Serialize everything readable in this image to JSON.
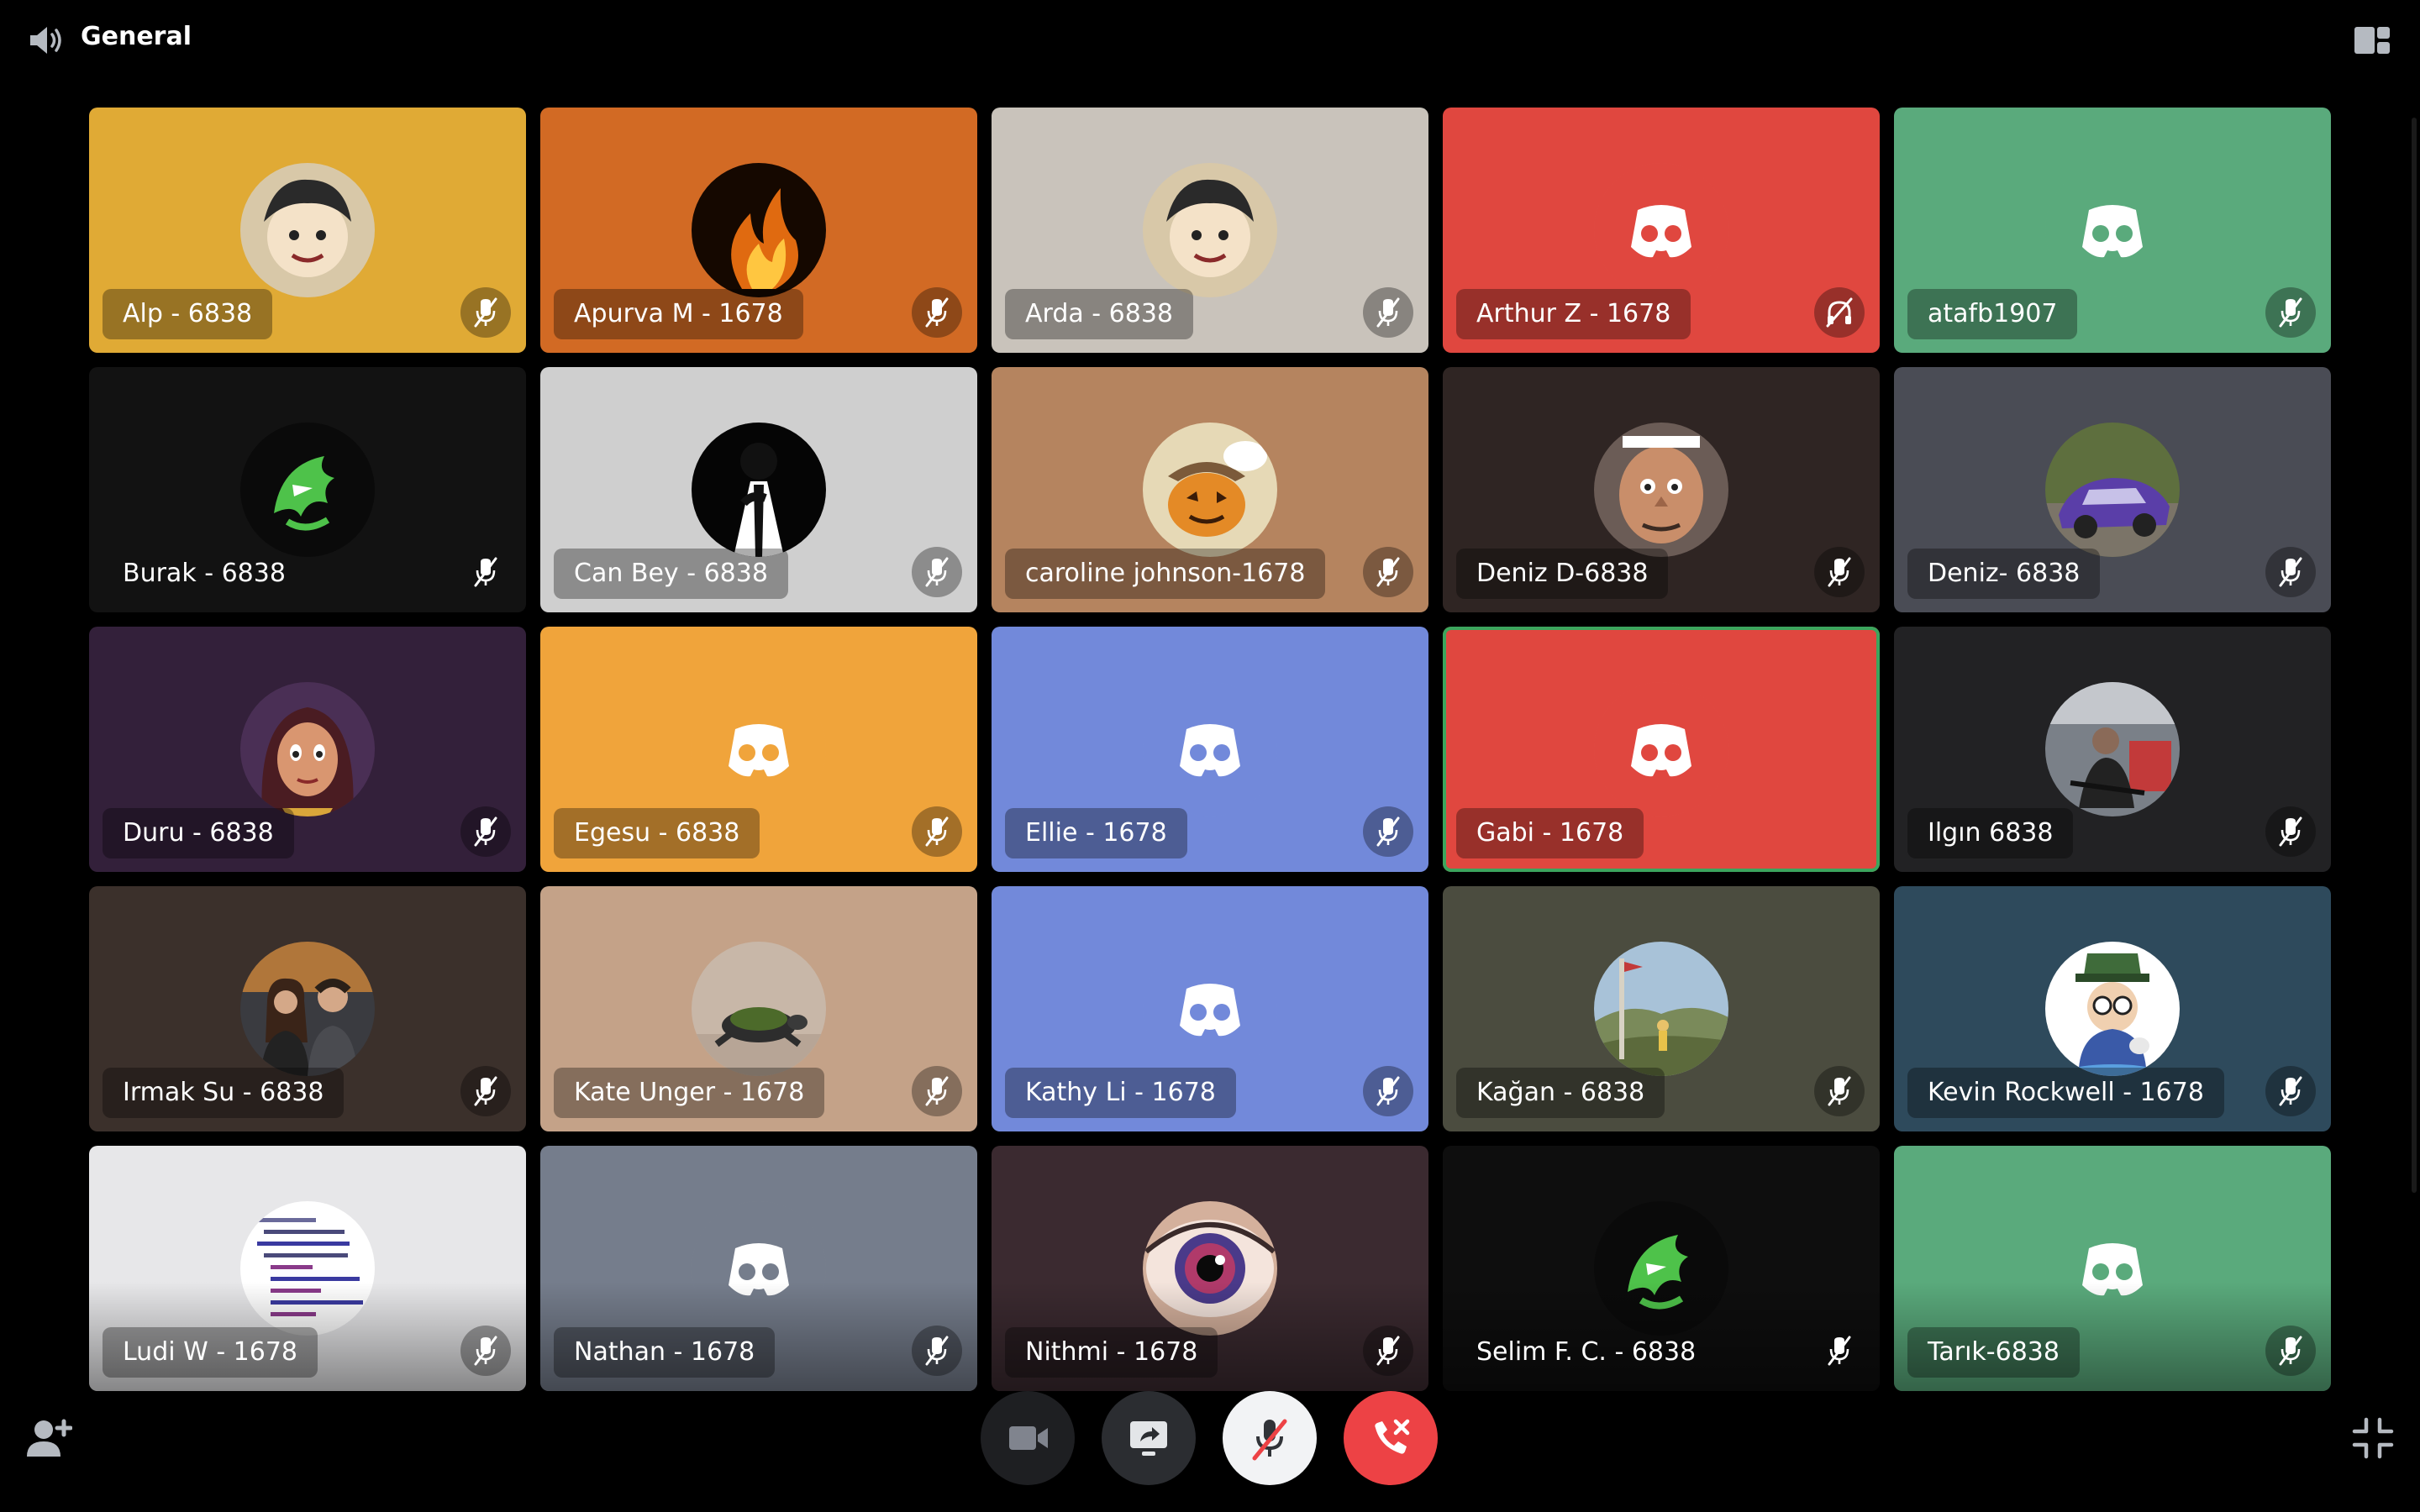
{
  "header": {
    "channel_name": "General",
    "channel_icon": "speaker-icon",
    "layout_icon": "grid-layout-icon"
  },
  "participants": [
    {
      "name": "Alp - 6838",
      "bg": "#e0aa35",
      "avatar": "anime-character",
      "muted": true,
      "status": "muted"
    },
    {
      "name": "Apurva M - 1678",
      "bg": "#d26a24",
      "avatar": "fire",
      "muted": true,
      "status": "muted"
    },
    {
      "name": "Arda - 6838",
      "bg": "#c9c3bb",
      "avatar": "anime-character",
      "muted": true,
      "status": "muted"
    },
    {
      "name": "Arthur Z - 1678",
      "bg": "#e0473f",
      "avatar": "discord-logo",
      "muted": true,
      "status": "deafened"
    },
    {
      "name": "atafb1907",
      "bg": "#5aaa7c",
      "avatar": "discord-logo",
      "muted": true,
      "status": "muted"
    },
    {
      "name": "Burak - 6838",
      "bg": "#121212",
      "avatar": "green-shark",
      "muted": true,
      "status": "muted"
    },
    {
      "name": "Can Bey - 6838",
      "bg": "#cfcfcf",
      "avatar": "suit-figure",
      "muted": true,
      "status": "muted"
    },
    {
      "name": "caroline johnson-1678",
      "bg": "#b5845f",
      "avatar": "pumpkin-comic",
      "muted": true,
      "status": "muted"
    },
    {
      "name": "Deniz D-6838",
      "bg": "#2f2523",
      "avatar": "cartoon-man",
      "muted": true,
      "status": "muted"
    },
    {
      "name": "Deniz- 6838",
      "bg": "#4a4c55",
      "avatar": "purple-car",
      "muted": true,
      "status": "muted"
    },
    {
      "name": "Duru - 6838",
      "bg": "#33203a",
      "avatar": "cartoon-girl",
      "muted": true,
      "status": "muted"
    },
    {
      "name": "Egesu - 6838",
      "bg": "#f0a43b",
      "avatar": "discord-logo",
      "muted": true,
      "status": "muted"
    },
    {
      "name": "Ellie - 1678",
      "bg": "#7289da",
      "avatar": "discord-logo",
      "muted": true,
      "status": "muted"
    },
    {
      "name": "Gabi - 1678",
      "bg": "#e0473f",
      "avatar": "discord-logo",
      "muted": false,
      "status": "speaking"
    },
    {
      "name": "Ilgın 6838",
      "bg": "#222224",
      "avatar": "person-photo",
      "muted": true,
      "status": "muted"
    },
    {
      "name": "Irmak Su - 6838",
      "bg": "#3b302b",
      "avatar": "two-people-photo",
      "muted": true,
      "status": "muted"
    },
    {
      "name": "Kate Unger - 1678",
      "bg": "#c4a288",
      "avatar": "turtle",
      "muted": true,
      "status": "muted"
    },
    {
      "name": "Kathy Li - 1678",
      "bg": "#7289da",
      "avatar": "discord-logo",
      "muted": true,
      "status": "muted"
    },
    {
      "name": "Kağan - 6838",
      "bg": "#4b4c3f",
      "avatar": "landscape-photo",
      "muted": true,
      "status": "muted"
    },
    {
      "name": "Kevin Rockwell - 1678",
      "bg": "#2e4a5c",
      "avatar": "cartoon-mascot",
      "muted": true,
      "status": "muted"
    },
    {
      "name": "Ludi W - 1678",
      "bg": "#e7e7e9",
      "avatar": "code-snippet",
      "muted": true,
      "status": "muted"
    },
    {
      "name": "Nathan - 1678",
      "bg": "#757d8c",
      "avatar": "discord-logo",
      "muted": true,
      "status": "muted"
    },
    {
      "name": "Nithmi - 1678",
      "bg": "#3b2a30",
      "avatar": "eye",
      "muted": true,
      "status": "muted"
    },
    {
      "name": "Selim F. C. - 6838",
      "bg": "#0e0e0e",
      "avatar": "green-shark",
      "muted": true,
      "status": "muted"
    },
    {
      "name": "Tarık-6838",
      "bg": "#5aaa7c",
      "avatar": "discord-logo",
      "muted": true,
      "status": "muted"
    }
  ],
  "controls": {
    "camera_icon": "video-camera-icon",
    "screen_share_icon": "screen-share-icon",
    "microphone_icon": "microphone-muted-icon",
    "leave_icon": "phone-hangup-icon",
    "invite_icon": "add-user-icon",
    "fullscreen_icon": "exit-fullscreen-icon"
  },
  "colors": {
    "background": "#000000",
    "speaking_outline": "#3ba55d",
    "leave_red": "#ed4245",
    "blurple": "#7289da"
  }
}
